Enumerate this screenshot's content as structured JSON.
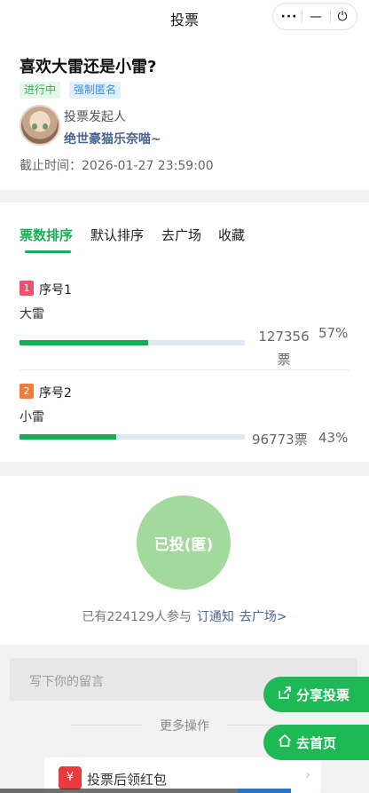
{
  "topbar": {
    "title": "投票",
    "capsule": {
      "more": "···",
      "minimize": "—",
      "power": "⏻"
    }
  },
  "poll": {
    "title": "喜欢大雷还是小雷?",
    "tags": [
      "进行中",
      "强制匿名"
    ],
    "initiator_label": "投票发起人",
    "initiator_name": "绝世豪猫乐奈喵~",
    "deadline_label": "截止时间：",
    "deadline_value": "2026-01-27 23:59:00"
  },
  "tabs": [
    "票数排序",
    "默认排序",
    "去广场",
    "收藏"
  ],
  "options": [
    {
      "rank": "1",
      "seq": "序号1",
      "name": "大雷",
      "votes": "127356票",
      "percent": "57%",
      "fraction": 0.57
    },
    {
      "rank": "2",
      "seq": "序号2",
      "name": "小雷",
      "votes": "96773票",
      "percent": "43%",
      "fraction": 0.43
    }
  ],
  "action": {
    "voted_label": "已投(匿)",
    "participation": "已有224129人参与",
    "subscribe": "订通知",
    "plaza": "去广场>"
  },
  "comment": {
    "placeholder": "写下你的留言"
  },
  "more_ops": "更多操作",
  "red_packet": {
    "icon": "¥",
    "label": "投票后领红包",
    "arrow": "›"
  },
  "fab": {
    "share": "分享投票",
    "home": "去首页",
    "share_icon": "share-icon",
    "home_icon": "home-icon"
  },
  "colors": {
    "accent": "#1aab55",
    "voted": "#a3d99c",
    "link": "#4a6591"
  }
}
